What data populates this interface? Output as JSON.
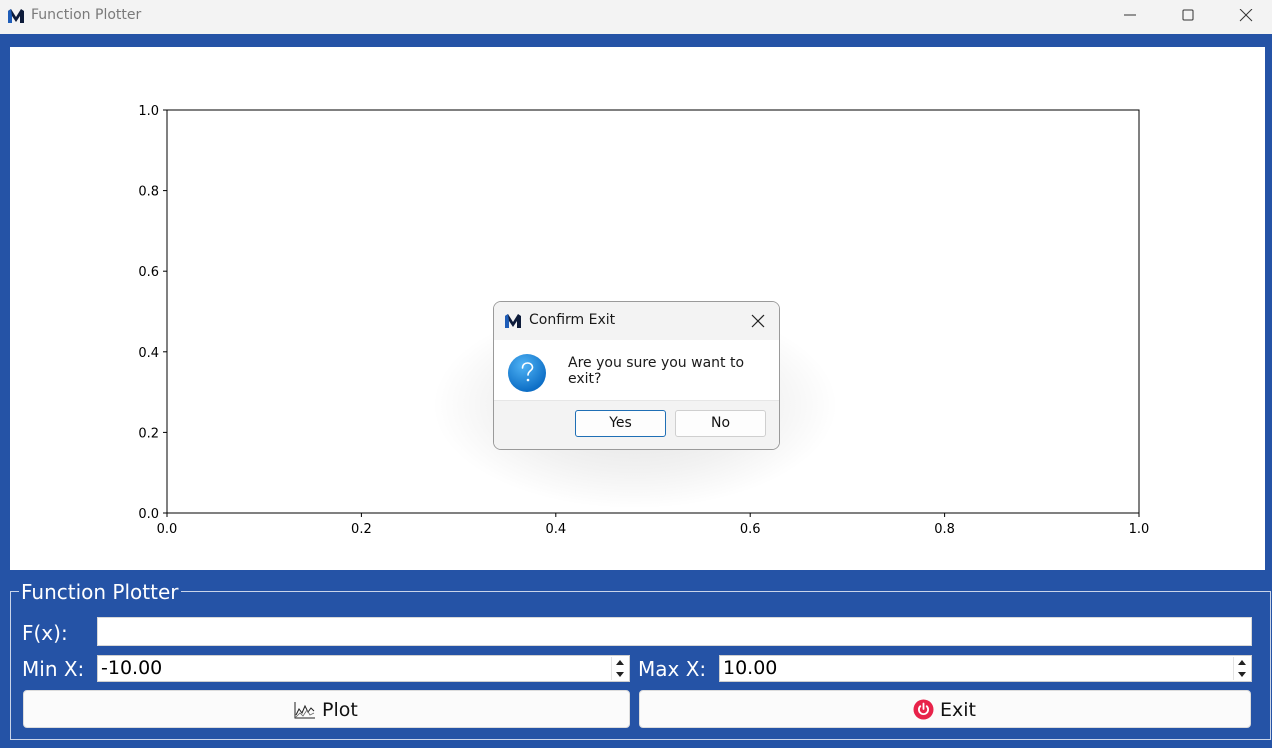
{
  "window": {
    "title": "Function Plotter"
  },
  "chart_data": {
    "type": "line",
    "series": [],
    "xlim": [
      0.0,
      1.0
    ],
    "ylim": [
      0.0,
      1.0
    ],
    "x_ticks": [
      "0.0",
      "0.2",
      "0.4",
      "0.6",
      "0.8",
      "1.0"
    ],
    "y_ticks": [
      "0.0",
      "0.2",
      "0.4",
      "0.6",
      "0.8",
      "1.0"
    ],
    "grid": false
  },
  "controls": {
    "group_title": "Function Plotter",
    "fx_label": "F(x):",
    "fx_value": "",
    "min_label": "Min X:",
    "min_value": "-10.00",
    "max_label": "Max X:",
    "max_value": "10.00",
    "plot_label": "Plot",
    "exit_label": "Exit"
  },
  "dialog": {
    "title": "Confirm Exit",
    "message": "Are you sure you want to exit?",
    "yes_label": "Yes",
    "no_label": "No"
  },
  "colors": {
    "window_background": "#2553a6",
    "exit_icon": "#e8234a",
    "question_icon": "#1283d6"
  },
  "icons": {
    "app": "matlab-style-m-logo",
    "plot": "line-chart-icon",
    "exit": "power-icon",
    "dialog": "question-icon"
  }
}
